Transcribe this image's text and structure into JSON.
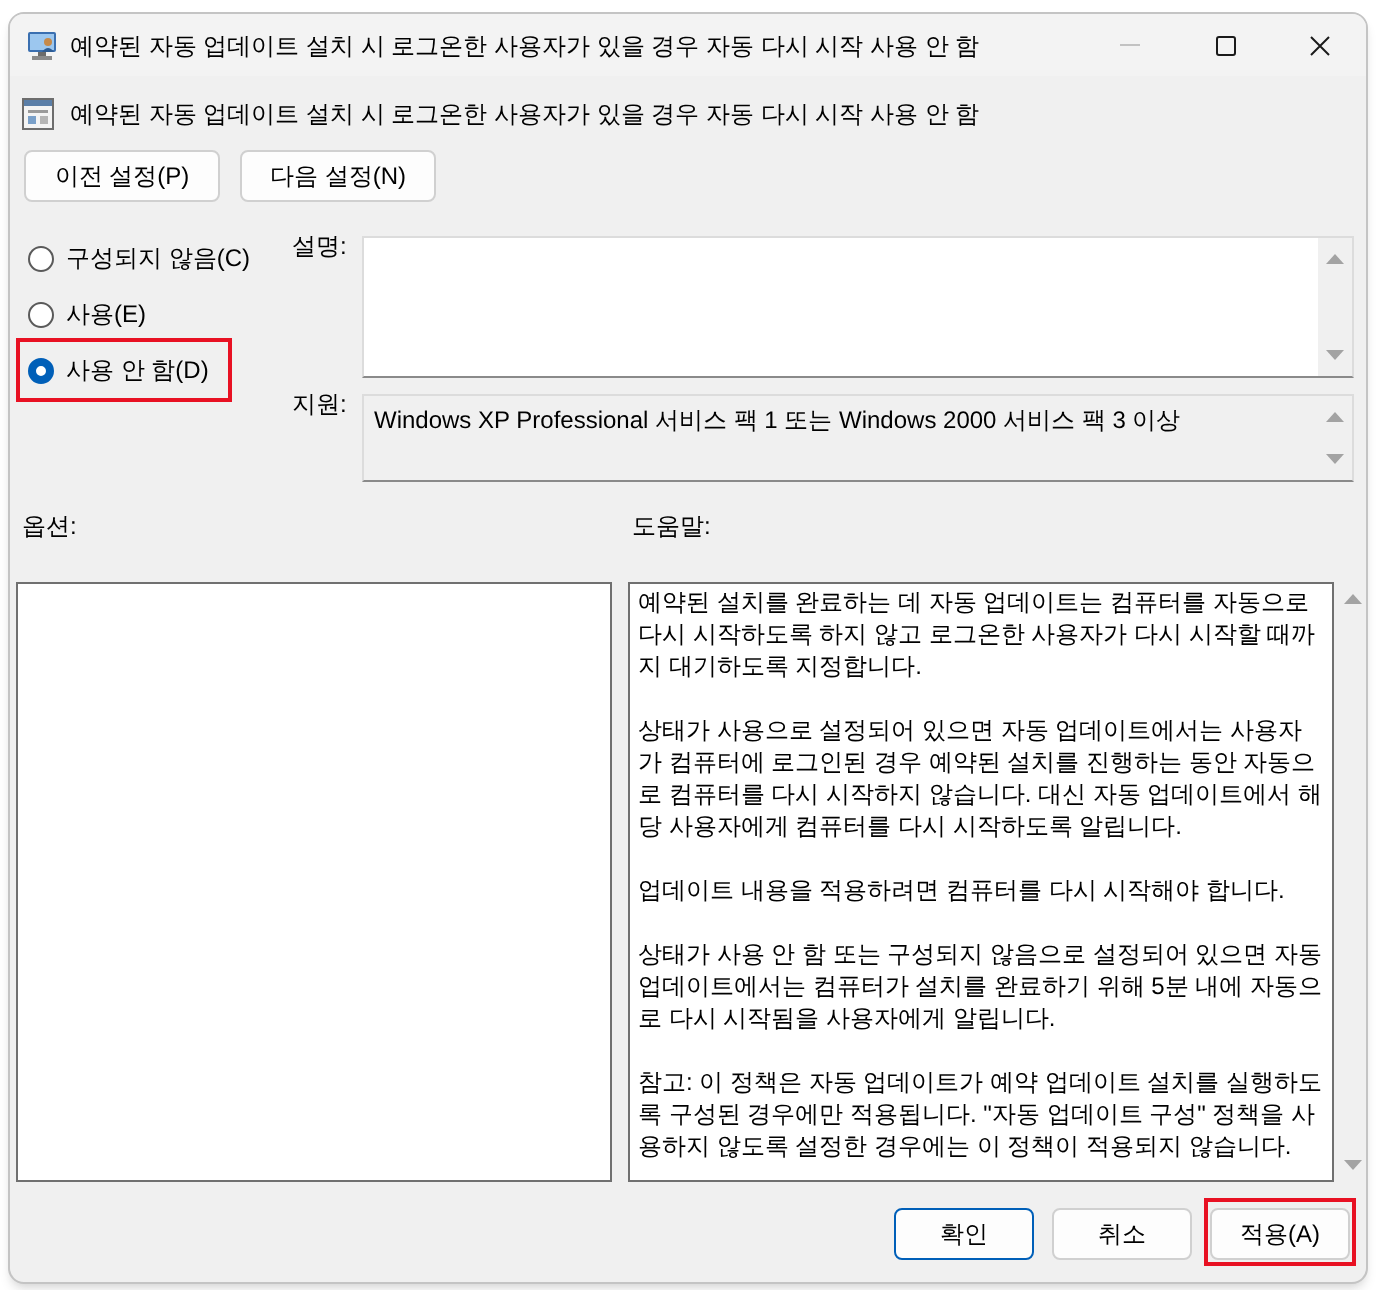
{
  "window": {
    "title": "예약된 자동 업데이트 설치 시 로그온한 사용자가 있을 경우 자동 다시 시작 사용 안 함"
  },
  "header": {
    "title": "예약된 자동 업데이트 설치 시 로그온한 사용자가 있을 경우 자동 다시 시작 사용 안 함"
  },
  "nav_buttons": [
    {
      "label": "이전 설정(P)"
    },
    {
      "label": "다음 설정(N)"
    }
  ],
  "state_options": [
    {
      "label": "구성되지 않음(C)",
      "selected": false,
      "highlighted": false
    },
    {
      "label": "사용(E)",
      "selected": false,
      "highlighted": false
    },
    {
      "label": "사용 안 함(D)",
      "selected": true,
      "highlighted": true
    }
  ],
  "comment": {
    "label": "설명:"
  },
  "supported_on": {
    "label": "지원:",
    "value": "Windows XP Professional 서비스 팩 1 또는 Windows 2000 서비스 팩 3 이상"
  },
  "options": {
    "label": "옵션:"
  },
  "help": {
    "label": "도움말:",
    "paragraphs": [
      "예약된 설치를 완료하는 데 자동 업데이트는 컴퓨터를 자동으로 다시 시작하도록 하지 않고 로그온한 사용자가 다시 시작할 때까지 대기하도록 지정합니다.",
      "상태가 사용으로 설정되어 있으면 자동 업데이트에서는 사용자가 컴퓨터에 로그인된 경우 예약된 설치를 진행하는 동안 자동으로 컴퓨터를 다시 시작하지 않습니다. 대신 자동 업데이트에서 해당 사용자에게 컴퓨터를 다시 시작하도록 알립니다.",
      "업데이트 내용을 적용하려면 컴퓨터를 다시 시작해야 합니다.",
      "상태가 사용 안 함 또는 구성되지 않음으로 설정되어 있으면 자동 업데이트에서는 컴퓨터가 설치를 완료하기 위해 5분 내에 자동으로 다시 시작됨을 사용자에게 알립니다.",
      "참고: 이 정책은 자동 업데이트가 예약 업데이트 설치를 실행하도록 구성된 경우에만 적용됩니다. \"자동 업데이트 구성\" 정책을 사용하지 않도록 설정한 경우에는 이 정책이 적용되지 않습니다."
    ]
  },
  "footer_buttons": [
    {
      "label": "확인",
      "default": true,
      "highlighted": false
    },
    {
      "label": "취소",
      "default": false,
      "highlighted": false
    },
    {
      "label": "적용(A)",
      "default": false,
      "highlighted": true
    }
  ]
}
